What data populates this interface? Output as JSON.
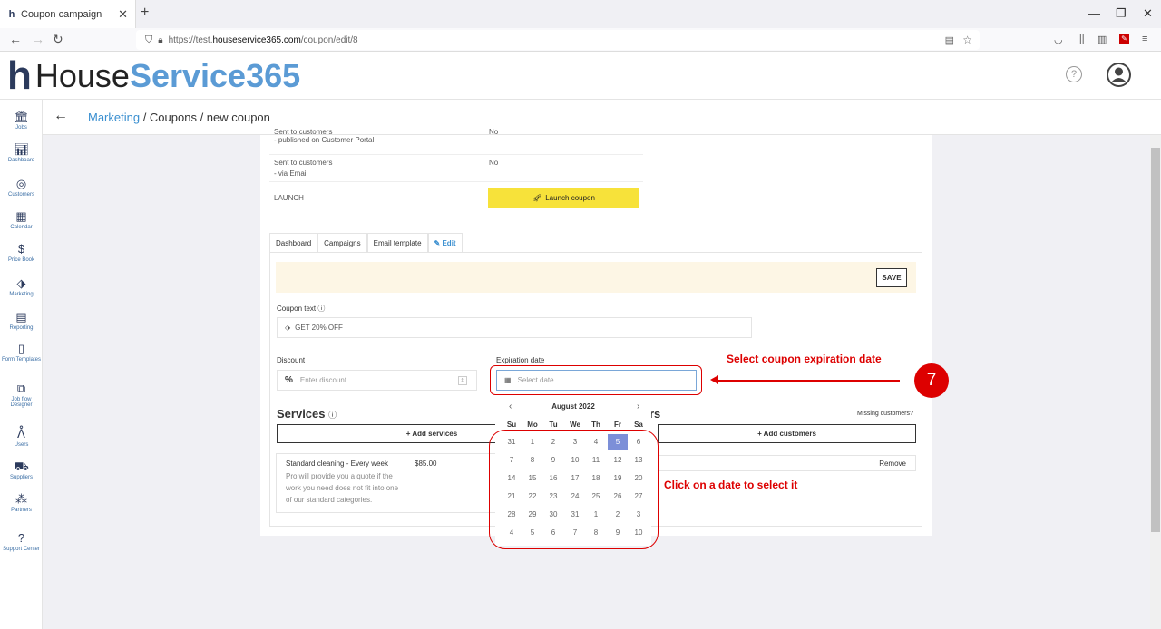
{
  "browser": {
    "tab_title": "Coupon campaign",
    "url_prefix": "https://test.",
    "url_domain": "houseservice365.com",
    "url_path": "/coupon/edit/8"
  },
  "brand": {
    "logo_part1": "House",
    "logo_part2": "Service365"
  },
  "sidebar": {
    "items": [
      {
        "label": "Jobs",
        "icon": "jobs-icon"
      },
      {
        "label": "Dashboard",
        "icon": "dashboard-icon"
      },
      {
        "label": "Customers",
        "icon": "customers-icon"
      },
      {
        "label": "Calendar",
        "icon": "calendar-icon"
      },
      {
        "label": "Price Book",
        "icon": "price-book-icon"
      },
      {
        "label": "Marketing",
        "icon": "marketing-icon"
      },
      {
        "label": "Reporting",
        "icon": "reporting-icon"
      },
      {
        "label": "Form Templates",
        "icon": "form-templates-icon"
      },
      {
        "label": "Job flow Designer",
        "icon": "job-flow-icon"
      },
      {
        "label": "Users",
        "icon": "users-icon"
      },
      {
        "label": "Suppliers",
        "icon": "suppliers-icon"
      },
      {
        "label": "Partners",
        "icon": "partners-icon"
      },
      {
        "label": "Support Center",
        "icon": "support-icon"
      }
    ]
  },
  "breadcrumb": {
    "link": "Marketing",
    "rest": " / Coupons / new coupon"
  },
  "status_table": {
    "rows": [
      {
        "label": "Sent to customers",
        "sub": "- published on Customer Portal",
        "value": "No"
      },
      {
        "label": "Sent to customers",
        "sub": "- via Email",
        "value": "No"
      },
      {
        "label": "LAUNCH",
        "sub": "",
        "value": ""
      }
    ],
    "launch_button": "Launch coupon"
  },
  "tabs": [
    "Dashboard",
    "Campaigns",
    "Email template",
    "Edit"
  ],
  "form": {
    "save": "SAVE",
    "coupon_text_label": "Coupon text",
    "coupon_text_value": "GET 20% OFF",
    "discount_label": "Discount",
    "discount_placeholder": "Enter discount",
    "expiration_label": "Expiration date",
    "expiration_placeholder": "Select date"
  },
  "services": {
    "title": "Services",
    "add_button": "+ Add services",
    "item_name": "Standard cleaning - Every week",
    "item_price": "$85.00",
    "item_desc": "Pro will provide you a quote if the work you need does not fit into one of our standard categories."
  },
  "customers": {
    "title_suffix": "rs",
    "missing": "Missing customers?",
    "add_button": "+ Add customers",
    "remove": "Remove"
  },
  "calendar": {
    "month": "August 2022",
    "dow": [
      "Su",
      "Mo",
      "Tu",
      "We",
      "Th",
      "Fr",
      "Sa"
    ],
    "weeks": [
      [
        "31",
        "1",
        "2",
        "3",
        "4",
        "5",
        "6"
      ],
      [
        "7",
        "8",
        "9",
        "10",
        "11",
        "12",
        "13"
      ],
      [
        "14",
        "15",
        "16",
        "17",
        "18",
        "19",
        "20"
      ],
      [
        "21",
        "22",
        "23",
        "24",
        "25",
        "26",
        "27"
      ],
      [
        "28",
        "29",
        "30",
        "31",
        "1",
        "2",
        "3"
      ],
      [
        "4",
        "5",
        "6",
        "7",
        "8",
        "9",
        "10"
      ]
    ],
    "selected": "5"
  },
  "annotations": {
    "step": "7",
    "select_date_text": "Select coupon expiration date",
    "click_date_text": "Click on a date to select it",
    "color": "#dd0000"
  }
}
